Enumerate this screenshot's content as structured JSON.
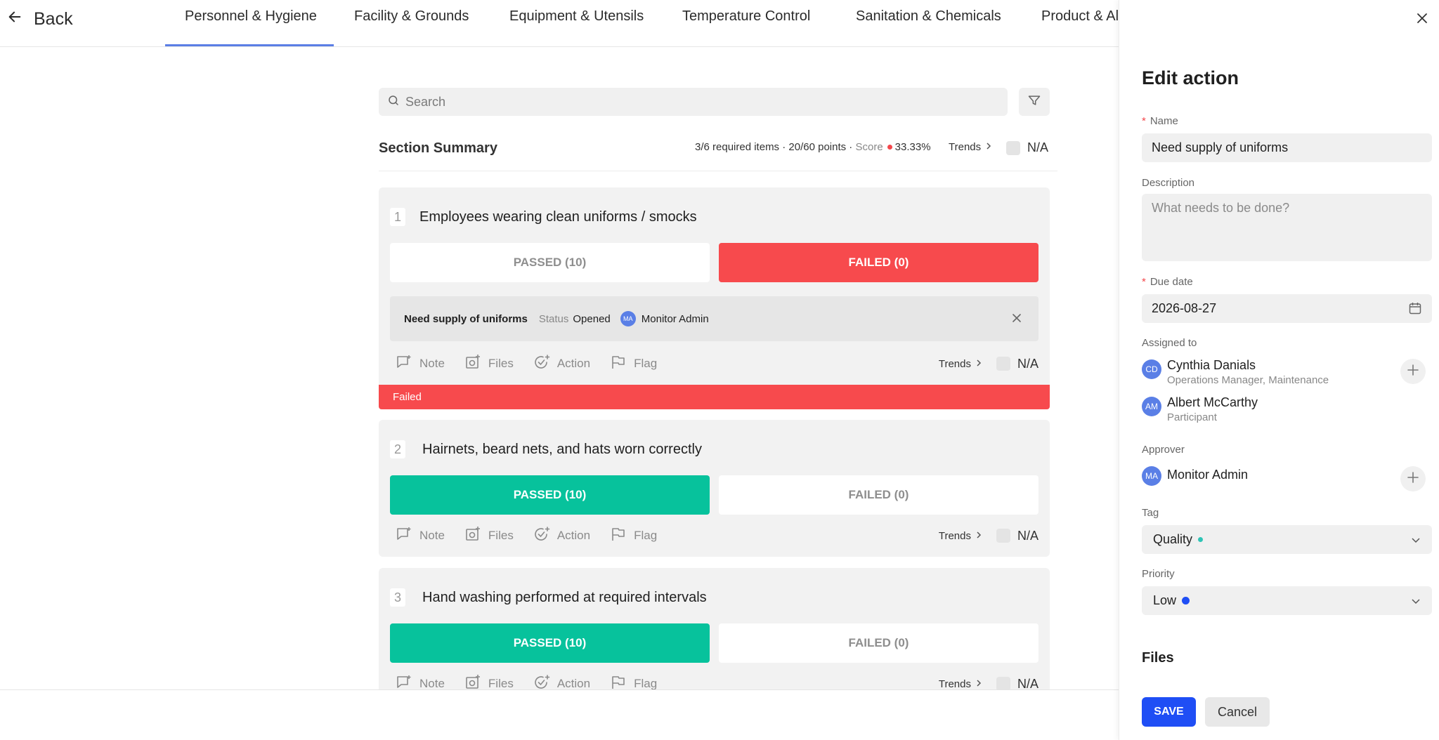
{
  "header": {
    "back_label": "Back",
    "tabs": [
      {
        "label": "Personnel & Hygiene"
      },
      {
        "label": "Facility & Grounds"
      },
      {
        "label": "Equipment & Utensils"
      },
      {
        "label": "Temperature Control"
      },
      {
        "label": "Sanitation & Chemicals"
      },
      {
        "label": "Product & Al"
      }
    ],
    "active_tab": "Personnel & Hygiene"
  },
  "search": {
    "placeholder": "Search"
  },
  "summary": {
    "title": "Section Summary",
    "required_items": "3/6 required items",
    "points": "20/60 points",
    "score_label": "Score",
    "score_value": "33.33%",
    "trends_label": "Trends",
    "na_label": "N/A",
    "sep": " · "
  },
  "tool_labels": {
    "note": "Note",
    "files": "Files",
    "action": "Action",
    "flag": "Flag",
    "trends": "Trends",
    "na": "N/A"
  },
  "items": [
    {
      "number": "1",
      "question": "Employees wearing clean uniforms / smocks",
      "passed_label": "PASSED (10)",
      "failed_label": "FAILED (0)",
      "result": "failed",
      "action": {
        "name": "Need supply of uniforms",
        "status_label": "Status",
        "status_value": "Opened",
        "assignee_initials": "MA",
        "assignee_name": "Monitor Admin"
      },
      "strip_label": "Failed"
    },
    {
      "number": "2",
      "question": "Hairnets, beard nets, and hats worn correctly",
      "passed_label": "PASSED (10)",
      "failed_label": "FAILED (0)",
      "result": "passed"
    },
    {
      "number": "3",
      "question": "Hand washing performed at required intervals",
      "passed_label": "PASSED (10)",
      "failed_label": "FAILED (0)",
      "result": "passed"
    }
  ],
  "panel": {
    "title": "Edit action",
    "name_label": "Name",
    "name_value": "Need supply of uniforms",
    "description_label": "Description",
    "description_placeholder": "What needs to be done?",
    "due_date_label": "Due date",
    "due_date_value": "2026-08-27",
    "assigned_label": "Assigned to",
    "assignees": [
      {
        "initials": "CD",
        "name": "Cynthia Danials",
        "role": "Operations Manager, Maintenance"
      },
      {
        "initials": "AM",
        "name": "Albert McCarthy",
        "role": "Participant"
      }
    ],
    "approver_label": "Approver",
    "approver": {
      "initials": "MA",
      "name": "Monitor Admin"
    },
    "tag_label": "Tag",
    "tag_value": "Quality",
    "priority_label": "Priority",
    "priority_value": "Low",
    "files_label": "Files",
    "save_label": "SAVE",
    "cancel_label": "Cancel"
  },
  "colors": {
    "accent": "#1f4ef5",
    "passed": "#07c29c",
    "failed": "#f74a4d",
    "tab_underline": "#5b7ee5",
    "tag_dot": "#2ec4b6",
    "priority_dot": "#1f4ef5",
    "avatar": "#5a7fe6"
  },
  "icons": {
    "back": "arrow-left-icon",
    "search": "search-icon",
    "filter": "filter-icon",
    "note": "note-icon",
    "files": "camera-icon",
    "action": "check-circle-icon",
    "flag": "flag-icon",
    "close": "close-icon",
    "calendar": "calendar-icon",
    "plus": "plus-icon",
    "chevron": "chevron-down-icon"
  }
}
